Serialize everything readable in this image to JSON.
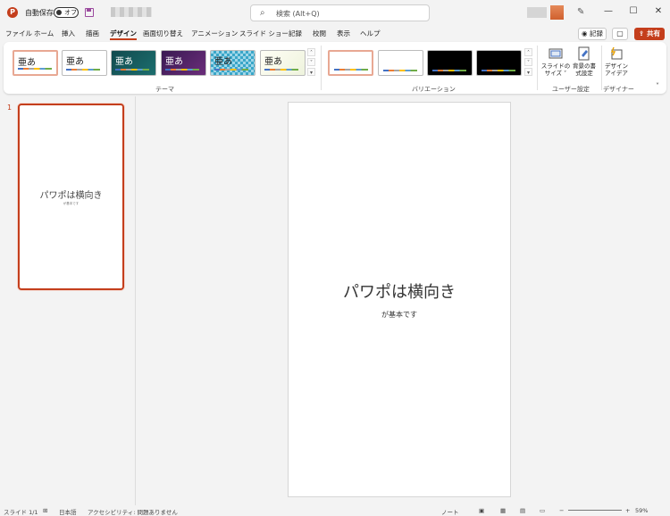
{
  "titlebar": {
    "autosave_label": "自動保存",
    "autosave_toggle": "オフ",
    "search_placeholder": "検索 (Alt+Q)",
    "minimize": "—",
    "maximize": "☐",
    "close": "✕"
  },
  "menu": {
    "tabs": [
      "ファイル",
      "ホーム",
      "挿入",
      "描画",
      "デザイン",
      "画面切り替え",
      "アニメーション",
      "スライド ショー",
      "記録",
      "校閲",
      "表示",
      "ヘルプ"
    ],
    "active_tab": "デザイン",
    "record_label": "記録",
    "share_label": "共有"
  },
  "ribbon": {
    "themes_label": "テーマ",
    "theme_glyphs": [
      "亜あ",
      "亜あ",
      "亜あ",
      "亜あ",
      "亜あ",
      "亜あ"
    ],
    "variations_label": "バリエーション",
    "slide_size_label": [
      "スライドの",
      "サイズ ˅"
    ],
    "bg_format_label": [
      "背景の書",
      "式設定"
    ],
    "user_settings_label": "ユーザー設定",
    "designer_btn_label": [
      "デザイン",
      "アイデア"
    ],
    "designer_label": "デザイナー"
  },
  "slides_panel": {
    "slide_number": "1",
    "thumb_title": "パワポは横向き",
    "thumb_sub": "が基本です"
  },
  "slide": {
    "title": "パワポは横向き",
    "subtitle": "が基本です"
  },
  "statusbar": {
    "slide_count": "スライド 1/1",
    "language": "日本語",
    "accessibility": "アクセシビリティ: 問題ありません",
    "notes": "ノート",
    "zoom": "59%"
  },
  "colors": {
    "accent": "#c43e1c",
    "ribbon_bg": "#ffffff",
    "app_bg": "#f3f3f3"
  }
}
